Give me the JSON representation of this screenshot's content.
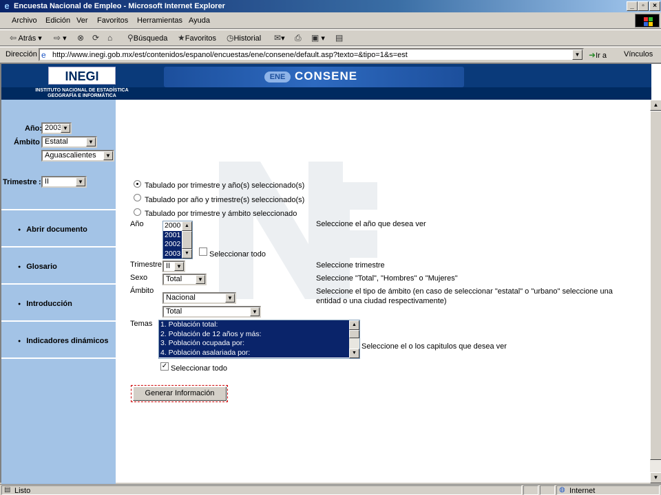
{
  "window": {
    "title": "Encuesta Nacional de Empleo - Microsoft Internet Explorer"
  },
  "menu": [
    "Archivo",
    "Edición",
    "Ver",
    "Favoritos",
    "Herramientas",
    "Ayuda"
  ],
  "toolbar": {
    "back": "Atrás",
    "search": "Búsqueda",
    "favorites": "Favoritos",
    "history": "Historial"
  },
  "address": {
    "label": "Dirección",
    "url": "http://www.inegi.gob.mx/est/contenidos/espanol/encuestas/ene/consene/default.asp?texto=&tipo=1&s=est",
    "go": "Ir a",
    "links": "Vínculos"
  },
  "banner": {
    "logo": "INEGI",
    "subtitle": "INSTITUTO NACIONAL DE ESTADÍSTICA GEOGRAFÍA E INFORMÁTICA",
    "title": "CONSENE",
    "badge": "ENE"
  },
  "sidebar": {
    "year_label": "Año:",
    "year_value": "2003",
    "scope_label": "Ámbito",
    "scope_value": "Estatal",
    "state_value": "Aguascalientes",
    "quarter_label": "Trimestre",
    "quarter_value": "II",
    "nav": [
      "Abrir documento",
      "Glosario",
      "Introducción",
      "Indicadores dinámicos"
    ]
  },
  "form": {
    "radios": [
      "Tabulado por trimestre y año(s) seleccionado(s)",
      "Tabulado por año y trimestre(s) seleccionado(s)",
      "Tabulado por trimestre y ámbito seleccionado"
    ],
    "year_label": "Año",
    "years": [
      "2000",
      "2001",
      "2002",
      "2003"
    ],
    "select_all_years": "Seleccionar todo",
    "year_help": "Seleccione el año que desea ver",
    "quarter_label": "Trimestre",
    "quarter_value": "II",
    "quarter_help": "Seleccione trimestre",
    "sex_label": "Sexo",
    "sex_value": "Total",
    "sex_help": "Seleccione \"Total\", \"Hombres\" o \"Mujeres\"",
    "scope_label": "Ámbito",
    "scope_value": "Nacional",
    "scope_sub_value": "Total",
    "scope_help_1": "Seleccione el tipo de ámbito (en caso de seleccionar \"estatal\" o \"urbano\" seleccione una",
    "scope_help_2": "entidad o una ciudad respectivamente)",
    "topics_label": "Temas",
    "topics": [
      "1. Población total:",
      "2. Población de 12 años y más:",
      "3. Población ocupada por:",
      "4. Población asalariada por:"
    ],
    "topics_help": "Seleccione el o los capitulos que desea ver",
    "select_all_topics": "Seleccionar todo",
    "generate": "Generar Información"
  },
  "status": {
    "text": "Listo",
    "zone": "Internet"
  }
}
